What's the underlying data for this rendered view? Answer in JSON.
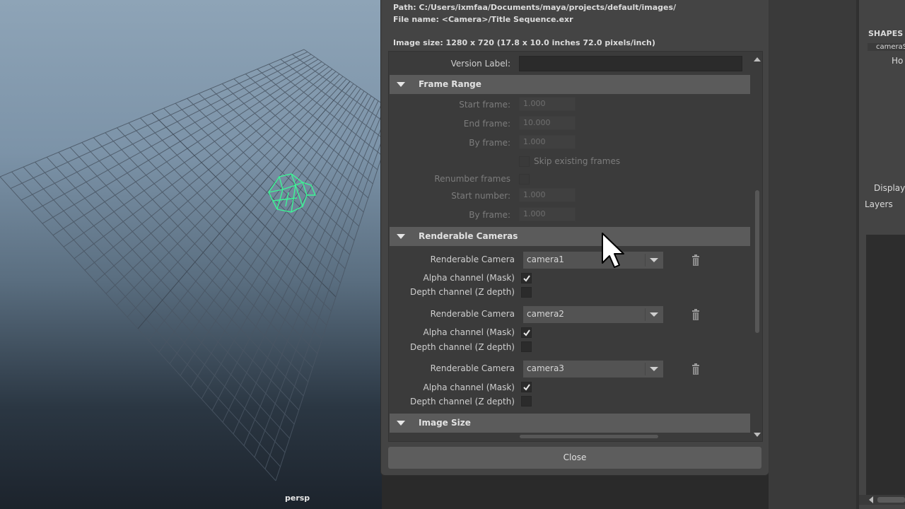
{
  "viewport": {
    "camera_label": "persp",
    "camera_wire_color": "#3df596"
  },
  "dialog": {
    "path_text": "Path: C:/Users/ixmfaa/Documents/maya/projects/default/images/",
    "file_name_text": "File name:  <Camera>/Title Sequence.exr",
    "image_size_text": "Image size: 1280 x 720 (17.8 x 10.0 inches 72.0 pixels/inch)",
    "version_label": "Version Label:",
    "version_value": "",
    "frame_range": {
      "title": "Frame Range",
      "start_frame_label": "Start frame:",
      "start_frame_value": "1.000",
      "end_frame_label": "End frame:",
      "end_frame_value": "10.000",
      "by_frame_label": "By frame:",
      "by_frame_value": "1.000",
      "skip_existing_label": "Skip existing frames",
      "renumber_label": "Renumber frames",
      "start_number_label": "Start number:",
      "start_number_value": "1.000",
      "by_frame2_label": "By frame:",
      "by_frame2_value": "1.000"
    },
    "renderable_cameras": {
      "title": "Renderable Cameras",
      "cameras": [
        {
          "label": "Renderable Camera",
          "value": "camera1",
          "alpha_label": "Alpha channel (Mask)",
          "alpha_checked": true,
          "depth_label": "Depth channel (Z depth)",
          "depth_checked": false
        },
        {
          "label": "Renderable Camera",
          "value": "camera2",
          "alpha_label": "Alpha channel (Mask)",
          "alpha_checked": true,
          "depth_label": "Depth channel (Z depth)",
          "depth_checked": false
        },
        {
          "label": "Renderable Camera",
          "value": "camera3",
          "alpha_label": "Alpha channel (Mask)",
          "alpha_checked": true,
          "depth_label": "Depth channel (Z depth)",
          "depth_checked": false
        }
      ]
    },
    "image_size_section": {
      "title": "Image Size"
    },
    "close_label": "Close"
  },
  "right_panel": {
    "shapes_label": "SHAPES",
    "camera_item": "cameraS",
    "ho_text": "Ho",
    "display_tab": "Display",
    "layers_tab": "Layers"
  }
}
